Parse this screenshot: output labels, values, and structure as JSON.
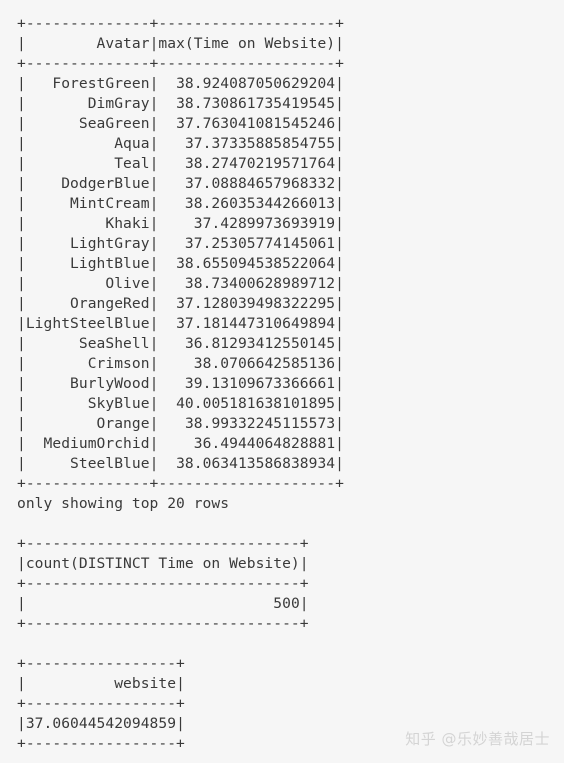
{
  "table1": {
    "headers": [
      "Avatar",
      "max(Time on Website)"
    ],
    "rows": [
      [
        "ForestGreen",
        "38.924087050629204"
      ],
      [
        "DimGray",
        "38.730861735419545"
      ],
      [
        "SeaGreen",
        "37.763041081545246"
      ],
      [
        "Aqua",
        "37.37335885854755"
      ],
      [
        "Teal",
        "38.27470219571764"
      ],
      [
        "DodgerBlue",
        "37.08884657968332"
      ],
      [
        "MintCream",
        "38.26035344266013"
      ],
      [
        "Khaki",
        "37.4289973693919"
      ],
      [
        "LightGray",
        "37.25305774145061"
      ],
      [
        "LightBlue",
        "38.655094538522064"
      ],
      [
        "Olive",
        "38.73400628989712"
      ],
      [
        "OrangeRed",
        "37.128039498322295"
      ],
      [
        "LightSteelBlue",
        "37.181447310649894"
      ],
      [
        "SeaShell",
        "36.81293412550145"
      ],
      [
        "Crimson",
        "38.0706642585136"
      ],
      [
        "BurlyWood",
        "39.13109673366661"
      ],
      [
        "SkyBlue",
        "40.005181638101895"
      ],
      [
        "Orange",
        "38.99332245115573"
      ],
      [
        "MediumOrchid",
        "36.4944064828881"
      ],
      [
        "SteelBlue",
        "38.063413586838934"
      ]
    ],
    "footer_note": "only showing top 20 rows"
  },
  "table2": {
    "headers": [
      "count(DISTINCT Time on Website)"
    ],
    "rows": [
      [
        "500"
      ]
    ]
  },
  "table3": {
    "headers": [
      "website"
    ],
    "rows": [
      [
        "37.06044542094859"
      ]
    ]
  },
  "watermark": "知乎 @乐妙善哉居士"
}
